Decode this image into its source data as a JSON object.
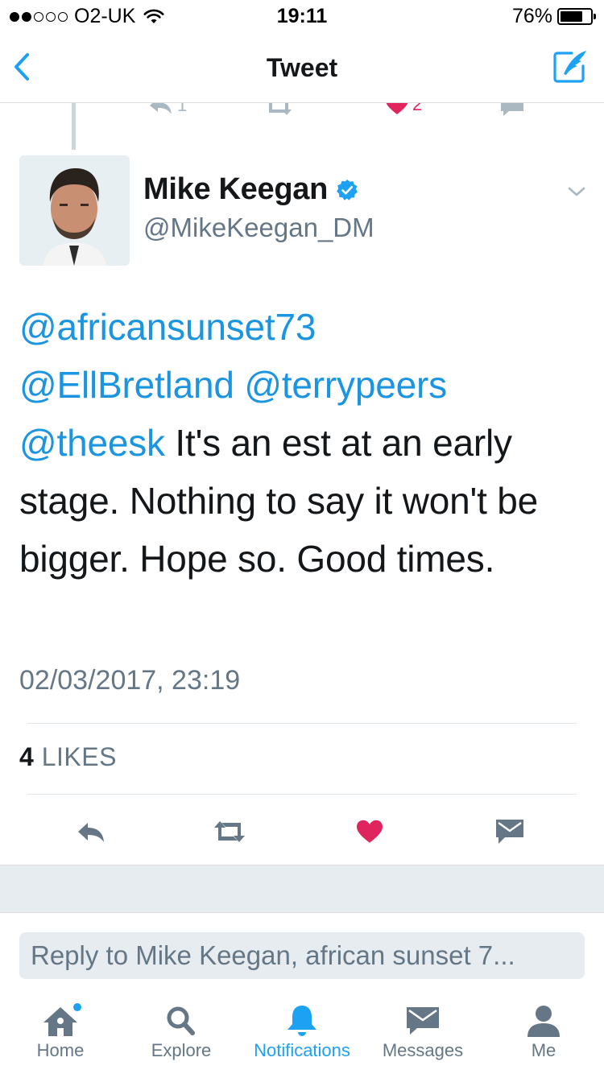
{
  "status_bar": {
    "carrier": "O2-UK",
    "time": "19:11",
    "battery": "76%",
    "battery_level": 0.76
  },
  "nav": {
    "title": "Tweet",
    "back_icon": "chevron-left-icon",
    "compose_icon": "compose-icon"
  },
  "previous_tweet": {
    "reply_count": "1",
    "like_count": "2"
  },
  "author": {
    "name": "Mike Keegan",
    "handle": "@MikeKeegan_DM",
    "verified": true
  },
  "tweet": {
    "mentions": [
      "@africansunset73",
      "@EllBretland",
      "@terrypeers",
      "@theesk"
    ],
    "text": "It's an est at an early stage. Nothing to say it won't be bigger. Hope so. Good times.",
    "timestamp": "02/03/2017, 23:19",
    "likes_count": "4",
    "likes_label": "LIKES",
    "liked": true
  },
  "reply": {
    "placeholder": "Reply to Mike Keegan, african sunset 7..."
  },
  "tabs": [
    {
      "label": "Home",
      "icon": "home-icon",
      "has_notification_dot": true
    },
    {
      "label": "Explore",
      "icon": "search-icon"
    },
    {
      "label": "Notifications",
      "icon": "bell-icon",
      "active": true
    },
    {
      "label": "Messages",
      "icon": "envelope-icon"
    },
    {
      "label": "Me",
      "icon": "person-icon"
    }
  ],
  "colors": {
    "accent": "#1da1f2",
    "mention": "#1b95e0",
    "like": "#e0245e",
    "muted": "#657786",
    "text": "#14171a"
  }
}
